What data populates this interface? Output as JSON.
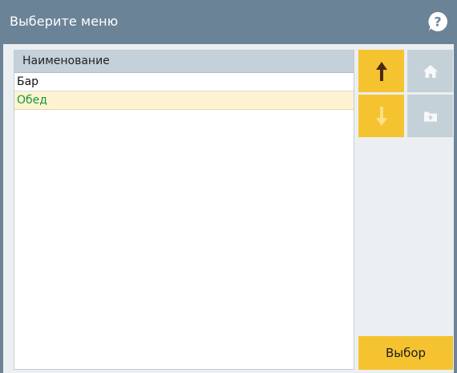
{
  "dialog": {
    "title": "Выберите меню",
    "help_icon": "question-icon"
  },
  "list": {
    "header": "Наименование",
    "items": [
      {
        "label": "Бар",
        "selected": false
      },
      {
        "label": "Обед",
        "selected": true
      }
    ]
  },
  "nav": {
    "up_icon": "arrow-up-icon",
    "down_icon": "arrow-down-icon",
    "home_icon": "home-icon",
    "folder_icon": "folder-up-icon"
  },
  "actions": {
    "select_label": "Выбор"
  },
  "colors": {
    "titlebar": "#6b8397",
    "accent": "#f5c330",
    "disabled": "#c5d1d9",
    "selected_row": "#fdf3d3",
    "selected_text": "#139a2c"
  }
}
